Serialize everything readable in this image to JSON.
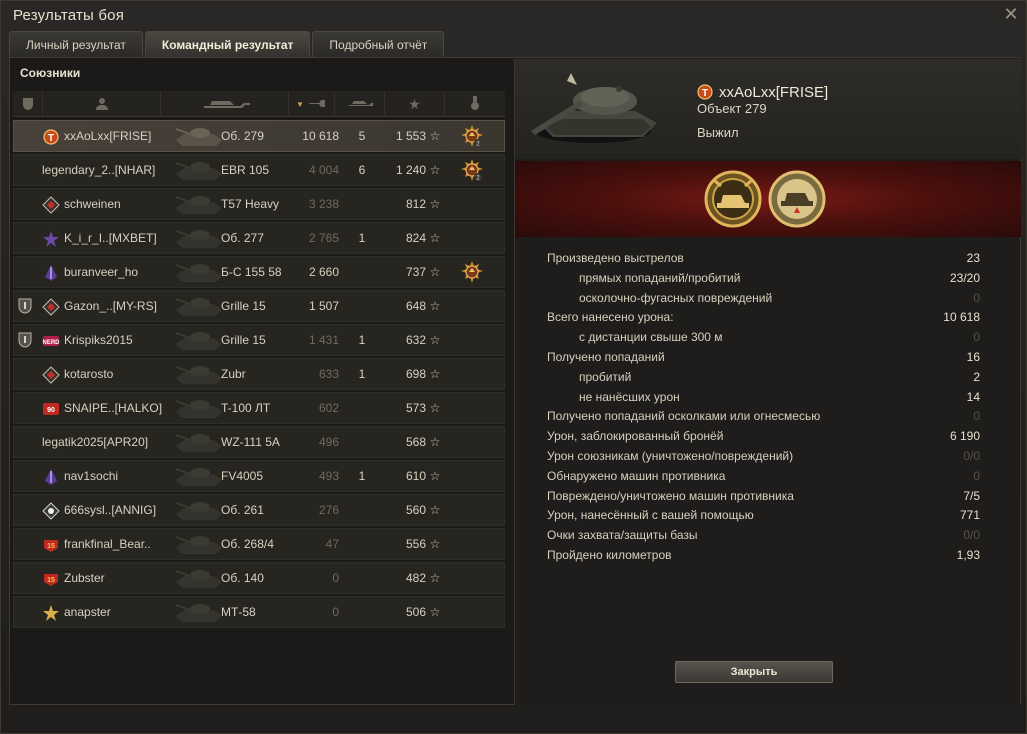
{
  "window": {
    "title": "Результаты боя"
  },
  "tabs": [
    {
      "label": "Личный результат",
      "active": false
    },
    {
      "label": "Командный результат",
      "active": true
    },
    {
      "label": "Подробный отчёт",
      "active": false
    }
  ],
  "team": {
    "title": "Союзники",
    "columns": [
      "badge-icon",
      "player-icon",
      "tank-icon",
      "damage-icon",
      "kills-icon",
      "xp-star-icon",
      "medal-icon"
    ],
    "rows": [
      {
        "name": "xxAoLxx[FRISE]",
        "vehicle": "Об. 279",
        "damage": "10 618",
        "kills": "5",
        "xp": "1 553",
        "medal": "2",
        "badge": "premium",
        "clan": "t-red",
        "me": true,
        "dmgDim": false
      },
      {
        "name": "legendary_2..[NHAR]",
        "vehicle": "EBR 105",
        "damage": "4 004",
        "kills": "6",
        "xp": "1 240",
        "medal": "2",
        "badge": "",
        "clan": "",
        "me": false,
        "dmgDim": true
      },
      {
        "name": "schweinen",
        "vehicle": "T57 Heavy",
        "damage": "3 238",
        "kills": "",
        "xp": "812",
        "medal": "",
        "badge": "",
        "clan": "diamond-red",
        "me": false,
        "dmgDim": true
      },
      {
        "name": "K_i_r_I..[MXBET]",
        "vehicle": "Об. 277",
        "damage": "2 765",
        "kills": "1",
        "xp": "824",
        "medal": "",
        "badge": "",
        "clan": "star-purple",
        "me": false,
        "dmgDim": true
      },
      {
        "name": "buranveer_ho",
        "vehicle": "Б-С 155 58",
        "damage": "2 660",
        "kills": "",
        "xp": "737",
        "medal": "1",
        "badge": "",
        "clan": "sword-purple",
        "me": false,
        "dmgDim": false
      },
      {
        "name": "Gazon_..[MY-RS]",
        "vehicle": "Grille 15",
        "damage": "1 507",
        "kills": "",
        "xp": "648",
        "medal": "",
        "badge": "shield",
        "clan": "diamond-red",
        "me": false,
        "dmgDim": false
      },
      {
        "name": "Krispiks2015",
        "vehicle": "Grille 15",
        "damage": "1 431",
        "kills": "1",
        "xp": "632",
        "medal": "",
        "badge": "shield",
        "clan": "nerd",
        "me": false,
        "dmgDim": true
      },
      {
        "name": "kotarosto",
        "vehicle": "Zubr",
        "damage": "633",
        "kills": "1",
        "xp": "698",
        "medal": "",
        "badge": "",
        "clan": "diamond-red",
        "me": false,
        "dmgDim": true
      },
      {
        "name": "SNAIPE..[HALKO]",
        "vehicle": "T-100 ЛТ",
        "damage": "602",
        "kills": "",
        "xp": "573",
        "medal": "",
        "badge": "",
        "clan": "red-90",
        "me": false,
        "dmgDim": true
      },
      {
        "name": "legatik2025[APR20]",
        "vehicle": "WZ-111 5A",
        "damage": "496",
        "kills": "",
        "xp": "568",
        "medal": "",
        "badge": "",
        "clan": "",
        "me": false,
        "dmgDim": true
      },
      {
        "name": "nav1sochi",
        "vehicle": "FV4005",
        "damage": "493",
        "kills": "1",
        "xp": "610",
        "medal": "",
        "badge": "",
        "clan": "sword-purple",
        "me": false,
        "dmgDim": true
      },
      {
        "name": "666sysl..[ANNIG]",
        "vehicle": "Об. 261",
        "damage": "276",
        "kills": "",
        "xp": "560",
        "medal": "",
        "badge": "",
        "clan": "diamond-white",
        "me": false,
        "dmgDim": true
      },
      {
        "name": "frankfinal_Bear..",
        "vehicle": "Об. 268/4",
        "damage": "47",
        "kills": "",
        "xp": "556",
        "medal": "",
        "badge": "",
        "clan": "red-15",
        "me": false,
        "dmgDim": true
      },
      {
        "name": "Zubster",
        "vehicle": "Об. 140",
        "damage": "0",
        "kills": "",
        "xp": "482",
        "medal": "",
        "badge": "",
        "clan": "red-15",
        "me": false,
        "dmgDim": true
      },
      {
        "name": "anapster",
        "vehicle": "МТ-58",
        "damage": "0",
        "kills": "",
        "xp": "506",
        "medal": "",
        "badge": "",
        "clan": "star-gold",
        "me": false,
        "dmgDim": true
      }
    ]
  },
  "player": {
    "name": "xxAoLxx[FRISE]",
    "vehicle": "Объект 279",
    "status": "Выжил"
  },
  "stats": [
    {
      "label": "Произведено выстрелов",
      "value": "23",
      "sub": false,
      "zero": false
    },
    {
      "label": "прямых попаданий/пробитий",
      "value": "23/20",
      "sub": true,
      "zero": false
    },
    {
      "label": "осколочно-фугасных повреждений",
      "value": "0",
      "sub": true,
      "zero": true
    },
    {
      "label": "Всего нанесено урона:",
      "value": "10 618",
      "sub": false,
      "zero": false
    },
    {
      "label": "с дистанции свыше 300 м",
      "value": "0",
      "sub": true,
      "zero": true
    },
    {
      "label": "Получено попаданий",
      "value": "16",
      "sub": false,
      "zero": false
    },
    {
      "label": "пробитий",
      "value": "2",
      "sub": true,
      "zero": false
    },
    {
      "label": "не нанёсших урон",
      "value": "14",
      "sub": true,
      "zero": false
    },
    {
      "label": "Получено попаданий осколками или огнесмесью",
      "value": "0",
      "sub": false,
      "zero": true
    },
    {
      "label": "Урон, заблокированный бронёй",
      "value": "6 190",
      "sub": false,
      "zero": false
    },
    {
      "label": "Урон союзникам (уничтожено/повреждений)",
      "value": "0/0",
      "sub": false,
      "zero": true
    },
    {
      "label": "Обнаружено машин противника",
      "value": "0",
      "sub": false,
      "zero": true
    },
    {
      "label": "Повреждено/уничтожено машин противника",
      "value": "7/5",
      "sub": false,
      "zero": false
    },
    {
      "label": "Урон, нанесённый с вашей помощью",
      "value": "771",
      "sub": false,
      "zero": false
    },
    {
      "label": "Очки захвата/защиты базы",
      "value": "0/0",
      "sub": false,
      "zero": true
    },
    {
      "label": "Пройдено километров",
      "value": "1,93",
      "sub": false,
      "zero": false
    }
  ],
  "buttons": {
    "close": "Закрыть"
  },
  "colors": {
    "accent": "#c9a34a",
    "awardBg": "#7a1a16"
  }
}
